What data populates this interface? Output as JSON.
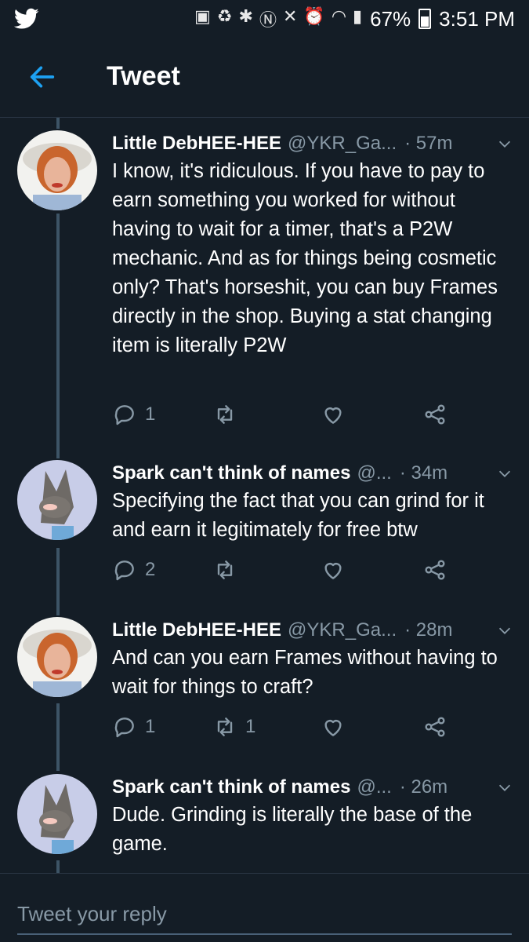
{
  "status_bar": {
    "battery": "67%",
    "time": "3:51 PM",
    "icons": [
      "twitter-icon",
      "save-icon",
      "recycle-icon",
      "bluetooth-icon",
      "nfc-icon",
      "mute-icon",
      "alarm-icon",
      "wifi-icon",
      "signal-icon",
      "battery-icon"
    ]
  },
  "header": {
    "title": "Tweet"
  },
  "tweets": [
    {
      "name": "Little DebHEE-HEE",
      "handle": "@YKR_Ga...",
      "time": "· 57m",
      "text": "I know, it's ridiculous. If you have to pay to earn something you worked for without having to wait for a timer, that's a P2W mechanic. And as for things being cosmetic only? That's horseshit, you can buy Frames directly in the shop. Buying a stat changing item is literally P2W",
      "replies": "1",
      "retweets": ""
    },
    {
      "name": "Spark can't think of names",
      "handle": "@...",
      "time": "· 34m",
      "text": "Specifying the fact that you can grind for it and earn it legitimately for free btw",
      "replies": "2",
      "retweets": ""
    },
    {
      "name": "Little DebHEE-HEE",
      "handle": "@YKR_Ga...",
      "time": "· 28m",
      "text": "And can you earn Frames without having to wait for things to craft?",
      "replies": "1",
      "retweets": "1"
    },
    {
      "name": "Spark can't think of names",
      "handle": "@...",
      "time": "· 26m",
      "text": "Dude. Grinding is literally the base of the game.",
      "replies": "",
      "retweets": ""
    }
  ],
  "reply": {
    "placeholder": "Tweet your reply"
  },
  "colors": {
    "background": "#141d26",
    "accent": "#1da1f2",
    "muted": "#8899a6"
  }
}
